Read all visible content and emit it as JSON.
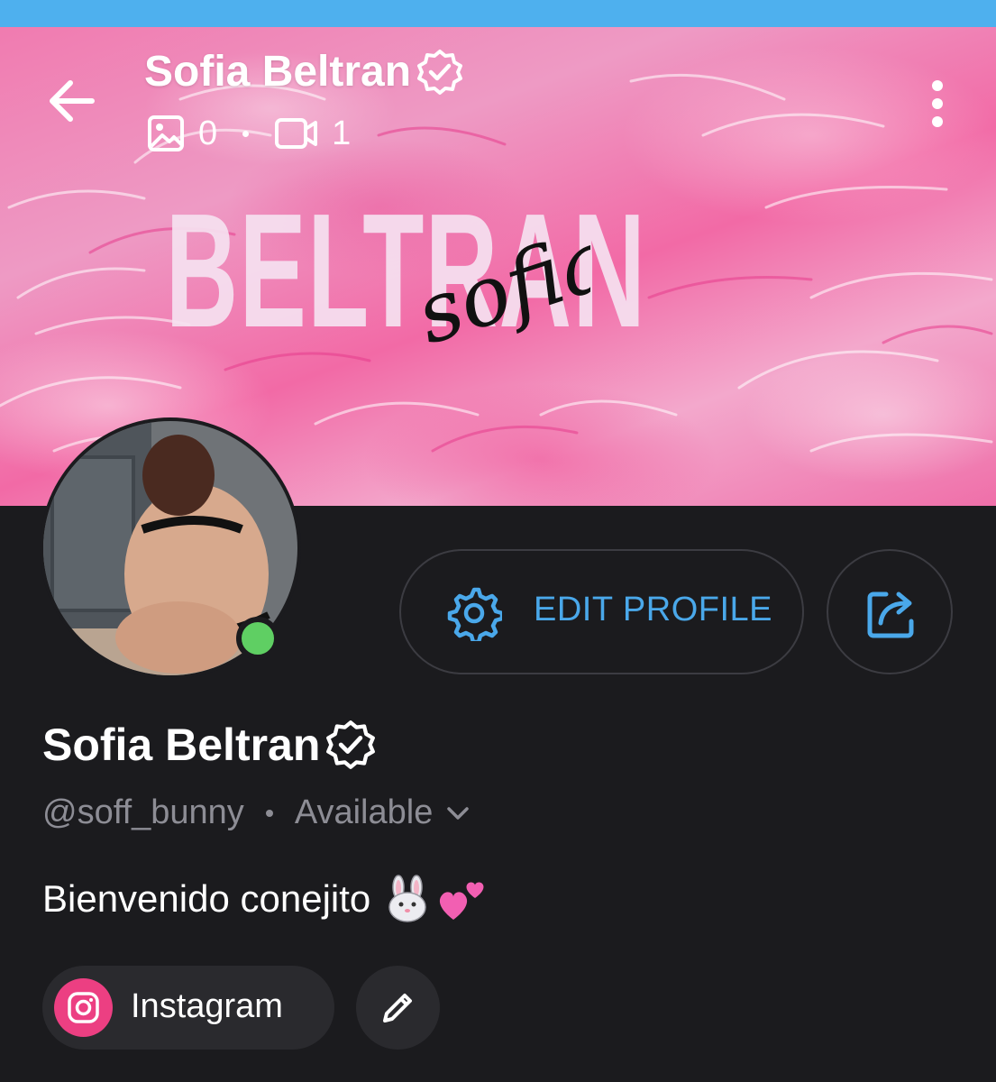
{
  "colors": {
    "top_strip": "#4eb0ee",
    "background": "#1b1b1e",
    "accent": "#4aa8ea",
    "online": "#5fcf63",
    "instagram": "#ec3f82",
    "muted_text": "#8d8d95"
  },
  "header": {
    "title": "Sofia Beltran",
    "verified_icon": "verified-badge-icon",
    "back_icon": "arrow-left-icon",
    "more_icon": "more-vertical-icon",
    "stats": {
      "photos_icon": "image-icon",
      "photos_count": "0",
      "videos_icon": "video-icon",
      "videos_count": "1"
    }
  },
  "cover": {
    "word": "BELTRAN",
    "script_word": "sofia"
  },
  "profile": {
    "avatar_icon": "avatar",
    "online": true,
    "edit_button_label": "EDIT PROFILE",
    "edit_icon": "gear-icon",
    "share_icon": "share-icon",
    "name": "Sofia Beltran",
    "handle": "@soff_bunny",
    "status": "Available",
    "status_icon": "chevron-down-icon",
    "bio_text": "Bienvenido conejito",
    "bio_emoji": [
      "rabbit-face",
      "two-hearts"
    ]
  },
  "links": [
    {
      "label": "Instagram",
      "icon": "instagram-icon"
    }
  ],
  "edit_links_icon": "pencil-icon"
}
